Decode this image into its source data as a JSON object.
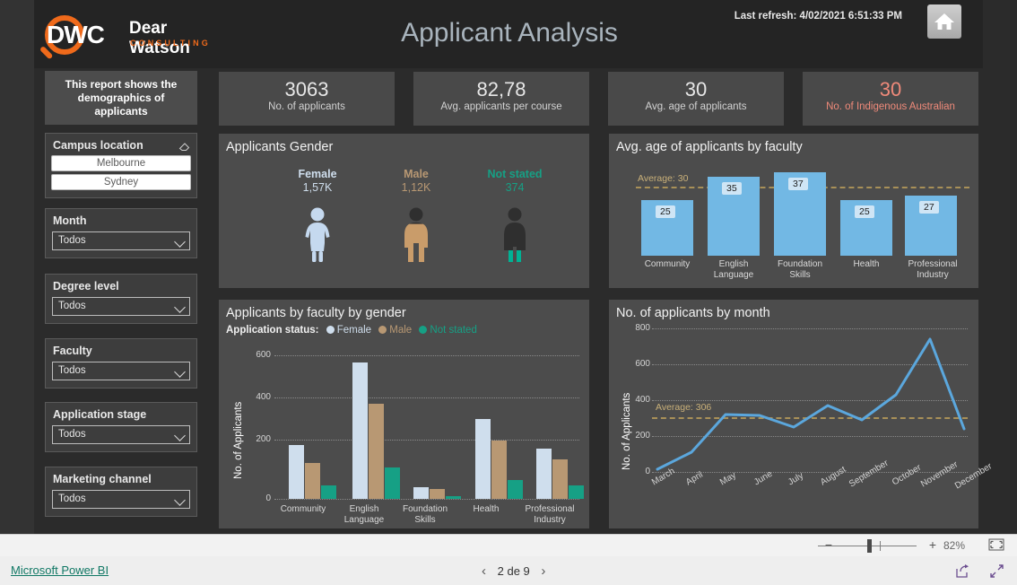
{
  "header": {
    "logo": {
      "mark": "DWC",
      "name": "Dear Watson",
      "tagline": "CONSULTING"
    },
    "title": "Applicant Analysis",
    "refresh": "Last refresh: 4/02/2021 6:51:33 PM",
    "home_icon": "home-icon"
  },
  "sidebar": {
    "info": "This report shows the demographics of applicants",
    "campus": {
      "title": "Campus location",
      "clear_icon": "eraser-icon",
      "options": [
        "Melbourne",
        "Sydney"
      ]
    },
    "slicers": [
      {
        "title": "Month",
        "value": "Todos"
      },
      {
        "title": "Degree level",
        "value": "Todos"
      },
      {
        "title": "Faculty",
        "value": "Todos"
      },
      {
        "title": "Application stage",
        "value": "Todos"
      },
      {
        "title": "Marketing channel",
        "value": "Todos"
      }
    ]
  },
  "kpis": [
    {
      "value": "3063",
      "label": "No. of applicants",
      "accent": false
    },
    {
      "value": "82,78",
      "label": "Avg. applicants per course",
      "accent": false
    },
    {
      "value": "30",
      "label": "Avg. age of applicants",
      "accent": false
    },
    {
      "value": "30",
      "label": "No. of Indigenous Australian",
      "accent": true
    }
  ],
  "gender_panel": {
    "title": "Applicants Gender",
    "items": [
      {
        "name": "Female",
        "value": "1,57K",
        "color": "#c5d9ef",
        "fill": 1.0
      },
      {
        "name": "Male",
        "value": "1,12K",
        "color": "#c99c6a",
        "fill": 0.7
      },
      {
        "name": "Not stated",
        "value": "374",
        "color": "#00b294",
        "fill": 0.22
      }
    ]
  },
  "colors": {
    "female": "#cfdeed",
    "male": "#b89873",
    "not_stated": "#16a085",
    "bar_blue": "#72b8e4",
    "average_line": "#a89058",
    "line_series": "#5ba7dd",
    "accent_salmon": "#f08a7a",
    "brand_orange": "#ef6a1b",
    "link_teal": "#117865"
  },
  "chart_data": [
    {
      "type": "bar",
      "title": "Avg. age of applicants by faculty",
      "categories": [
        "Community",
        "English Language",
        "Foundation Skills",
        "Health",
        "Professional Industry"
      ],
      "values": [
        25,
        35,
        37,
        25,
        27
      ],
      "ylim": [
        0,
        40
      ],
      "xlabel": "",
      "ylabel": "",
      "grid": false,
      "annotations": [
        {
          "label": "Average: 30",
          "value": 30
        }
      ]
    },
    {
      "type": "bar",
      "title": "Applicants by faculty by gender",
      "legend_title": "Application status:",
      "legend_position": "top",
      "categories": [
        "Community",
        "English Language",
        "Foundation Skills",
        "Health",
        "Professional Industry"
      ],
      "series": [
        {
          "name": "Female",
          "values": [
            255,
            645,
            55,
            380,
            240
          ]
        },
        {
          "name": "Male",
          "values": [
            170,
            450,
            45,
            275,
            185
          ]
        },
        {
          "name": "Not stated",
          "values": [
            65,
            150,
            12,
            90,
            65
          ]
        }
      ],
      "xlabel": "",
      "ylabel": "No. of Applicants",
      "yticks": [
        0,
        200,
        400,
        600
      ],
      "ylim": [
        0,
        680
      ],
      "grid": true
    },
    {
      "type": "line",
      "title": "No. of applicants by month",
      "x": [
        "March",
        "April",
        "May",
        "June",
        "July",
        "August",
        "September",
        "October",
        "November",
        "December"
      ],
      "values": [
        15,
        110,
        320,
        315,
        250,
        370,
        290,
        430,
        740,
        240
      ],
      "xlabel": "",
      "ylabel": "No. of Applicants",
      "yticks": [
        0,
        200,
        400,
        600,
        800
      ],
      "ylim": [
        0,
        800
      ],
      "grid": true,
      "annotations": [
        {
          "label": "Average: 306",
          "value": 306
        }
      ]
    }
  ],
  "statusbar": {
    "brand": "Microsoft Power BI",
    "page": "2 de 9",
    "prev_icon": "chevron-left-icon",
    "next_icon": "chevron-right-icon",
    "zoom": "82%",
    "fit_icon": "fit-to-page-icon",
    "share_icon": "share-icon",
    "fullscreen_icon": "fullscreen-icon"
  }
}
